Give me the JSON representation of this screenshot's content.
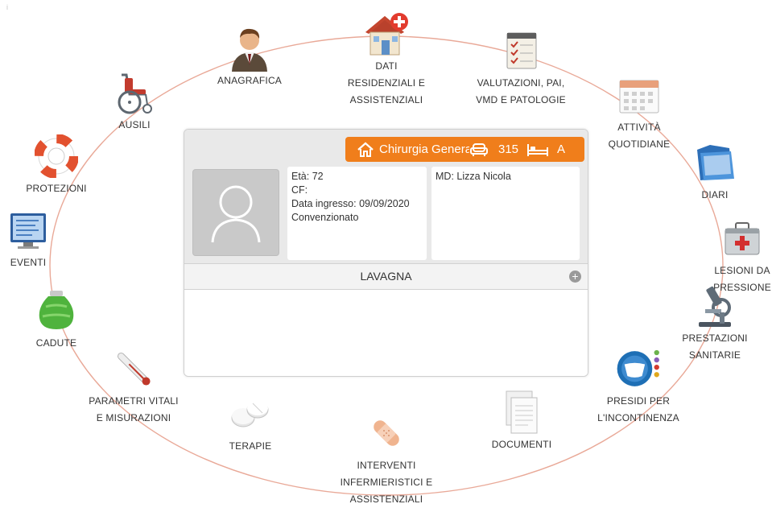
{
  "ring_color": "#e9a998",
  "accent_color": "#f07e1b",
  "corner_mark": "i",
  "categories": [
    {
      "key": "anagrafica",
      "label": "ANAGRAFICA",
      "icon": "user-icon"
    },
    {
      "key": "dati",
      "label": "DATI\nRESIDENZIALI E\nASSISTENZIALI",
      "icon": "house-icon"
    },
    {
      "key": "valutazioni",
      "label": "VALUTAZIONI, PAI,\nVMD E PATOLOGIE",
      "icon": "checklist-icon"
    },
    {
      "key": "attivita",
      "label": "ATTIVITÀ\nQUOTIDIANE",
      "icon": "calendar-icon"
    },
    {
      "key": "diari",
      "label": "DIARI",
      "icon": "folder-icon"
    },
    {
      "key": "lesioni",
      "label": "LESIONI DA\nPRESSIONE",
      "icon": "first-aid-kit-icon"
    },
    {
      "key": "prestazioni",
      "label": "PRESTAZIONI\nSANITARIE",
      "icon": "microscope-icon"
    },
    {
      "key": "presidi",
      "label": "PRESIDI PER\nL'INCONTINENZA",
      "icon": "diaper-icon"
    },
    {
      "key": "documenti",
      "label": "DOCUMENTI",
      "icon": "documents-icon"
    },
    {
      "key": "interventi",
      "label": "INTERVENTI\nINFERMIERISTICI E\nASSISTENZIALI",
      "icon": "bandage-icon"
    },
    {
      "key": "terapie",
      "label": "TERAPIE",
      "icon": "pills-icon"
    },
    {
      "key": "parametri",
      "label": "PARAMETRI VITALI\nE MISURAZIONI",
      "icon": "thermometer-icon"
    },
    {
      "key": "cadute",
      "label": "CADUTE",
      "icon": "ice-bag-icon"
    },
    {
      "key": "eventi",
      "label": "EVENTI",
      "icon": "monitor-icon"
    },
    {
      "key": "protezioni",
      "label": "PROTEZIONI",
      "icon": "lifebuoy-icon"
    },
    {
      "key": "ausili",
      "label": "AUSILI",
      "icon": "wheelchair-icon"
    }
  ],
  "card": {
    "ward": "Chirurgia Generale",
    "room": "315",
    "bed": "A",
    "patient": {
      "eta": "Età: 72",
      "cf": "CF:",
      "data_ingresso": "Data ingresso: 09/09/2020",
      "regime": "Convenzionato",
      "md": "MD: Lizza Nicola"
    },
    "lavagna_title": "LAVAGNA",
    "lavagna_add": "+"
  }
}
